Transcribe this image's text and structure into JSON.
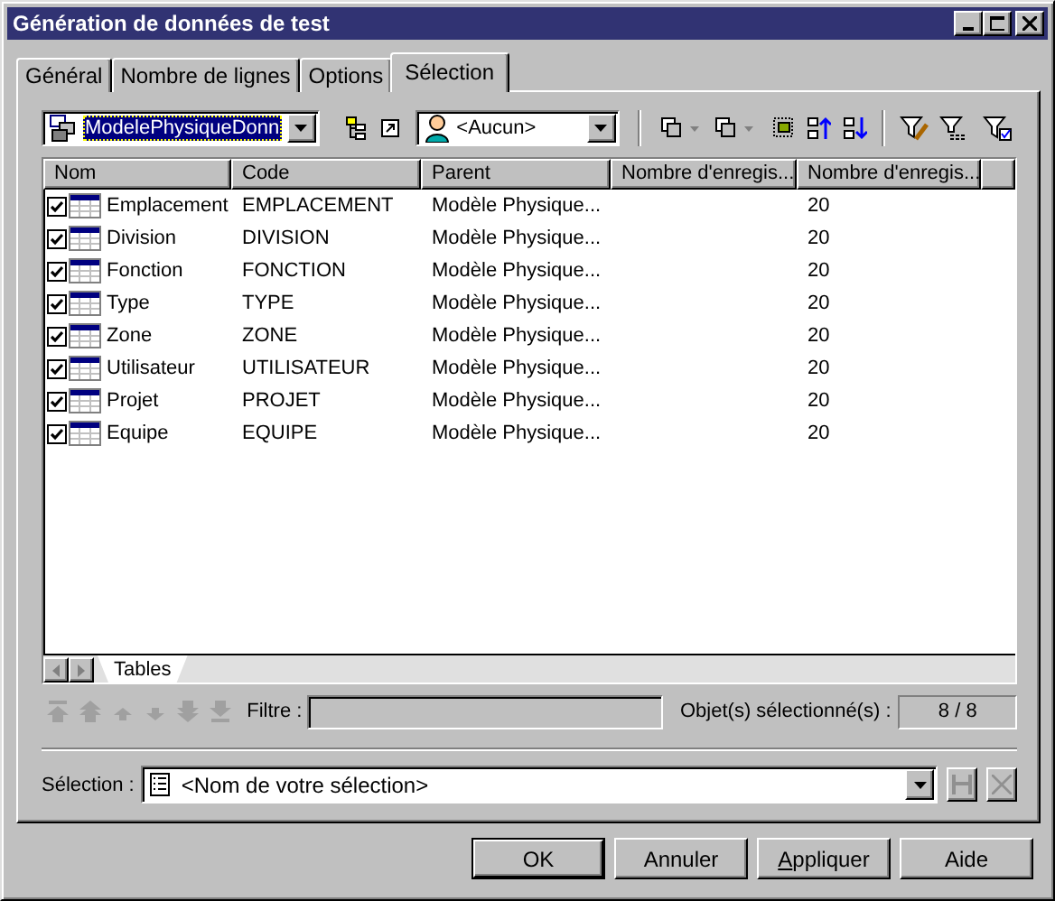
{
  "window": {
    "title": "Génération de données de test"
  },
  "tabs": [
    {
      "label": "Général",
      "selected": false
    },
    {
      "label": "Nombre de lignes",
      "selected": false
    },
    {
      "label": "Options",
      "selected": false
    },
    {
      "label": "Sélection",
      "selected": true
    }
  ],
  "toolbar": {
    "model": "ModelePhysiqueDonn",
    "owner": "<Aucun>"
  },
  "table": {
    "columns": [
      "Nom",
      "Code",
      "Parent",
      "Nombre d'enregis...",
      "Nombre d'enregis..."
    ],
    "rows": [
      {
        "checked": true,
        "nom": "Emplacement",
        "code": "EMPLACEMENT",
        "parent": "Modèle Physique...",
        "column_5": "20"
      },
      {
        "checked": true,
        "nom": "Division",
        "code": "DIVISION",
        "parent": "Modèle Physique...",
        "column_5": "20"
      },
      {
        "checked": true,
        "nom": "Fonction",
        "code": "FONCTION",
        "parent": "Modèle Physique...",
        "column_5": "20"
      },
      {
        "checked": true,
        "nom": "Type",
        "code": "TYPE",
        "parent": "Modèle Physique...",
        "column_5": "20"
      },
      {
        "checked": true,
        "nom": "Zone",
        "code": "ZONE",
        "parent": "Modèle Physique...",
        "column_5": "20"
      },
      {
        "checked": true,
        "nom": "Utilisateur",
        "code": "UTILISATEUR",
        "parent": "Modèle Physique...",
        "column_5": "20"
      },
      {
        "checked": true,
        "nom": "Projet",
        "code": "PROJET",
        "parent": "Modèle Physique...",
        "column_5": "20"
      },
      {
        "checked": true,
        "nom": "Equipe",
        "code": "EQUIPE",
        "parent": "Modèle Physique...",
        "column_5": "20"
      }
    ]
  },
  "sheet_tabs": [
    {
      "label": "Tables",
      "selected": true
    }
  ],
  "filter": {
    "label": "Filtre :"
  },
  "selected_objects": {
    "label": "Objet(s) sélectionné(s) :",
    "value": "8 / 8"
  },
  "selection": {
    "label": "Sélection :",
    "value": "<Nom de votre sélection>"
  },
  "buttons": [
    {
      "label": "OK",
      "default": true,
      "underline_first": false
    },
    {
      "label": "Annuler",
      "default": false,
      "underline_first": false
    },
    {
      "label": "Appliquer",
      "default": false,
      "underline_first": true
    },
    {
      "label": "Aide",
      "default": false,
      "underline_first": false
    }
  ]
}
